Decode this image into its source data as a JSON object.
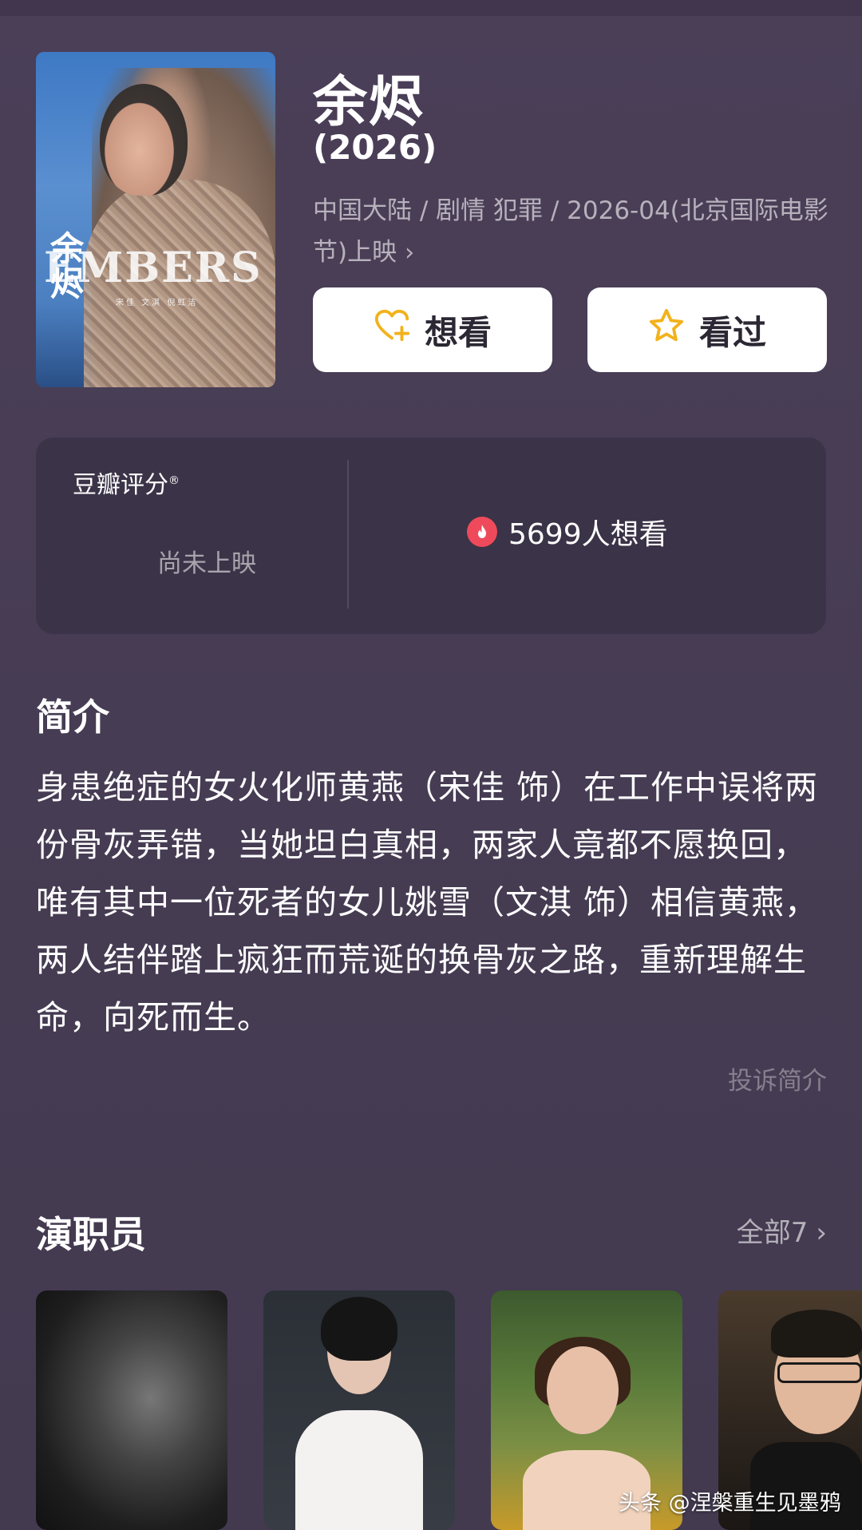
{
  "movie": {
    "title": "余烬",
    "year": "(2026)",
    "meta": "中国大陆 / 剧情 犯罪 / 2026-04(北京国际电影节)上映",
    "meta_chevron": "›"
  },
  "poster": {
    "title_en": "EMBERS",
    "title_cn": "余烬",
    "credits": "宋佳  文淇  倪虹洁"
  },
  "actions": {
    "want_label": "想看",
    "seen_label": "看过",
    "want_icon": "heart-plus-icon",
    "seen_icon": "star-icon"
  },
  "rating": {
    "label": "豆瓣评分",
    "label_mark": "®",
    "status": "尚未上映",
    "want_count": "5699人想看",
    "want_icon": "fire-icon"
  },
  "synopsis": {
    "title": "简介",
    "text": "身患绝症的女火化师黄燕（宋佳 饰）在工作中误将两份骨灰弄错，当她坦白真相，两家人竟都不愿换回，唯有其中一位死者的女儿姚雪（文淇 饰）相信黄燕，两人结伴踏上疯狂而荒诞的换骨灰之路，重新理解生命，向死而生。",
    "report_link": "投诉简介"
  },
  "cast": {
    "title": "演职员",
    "all_label": "全部7",
    "all_chevron": "›"
  },
  "watermark": "头条 @涅槃重生见墨鸦",
  "colors": {
    "background": "#4a3f57",
    "card": "#3b3347",
    "button": "#ffffff",
    "accent_yellow": "#f2b21c",
    "fire_red": "#ef4a5c"
  }
}
